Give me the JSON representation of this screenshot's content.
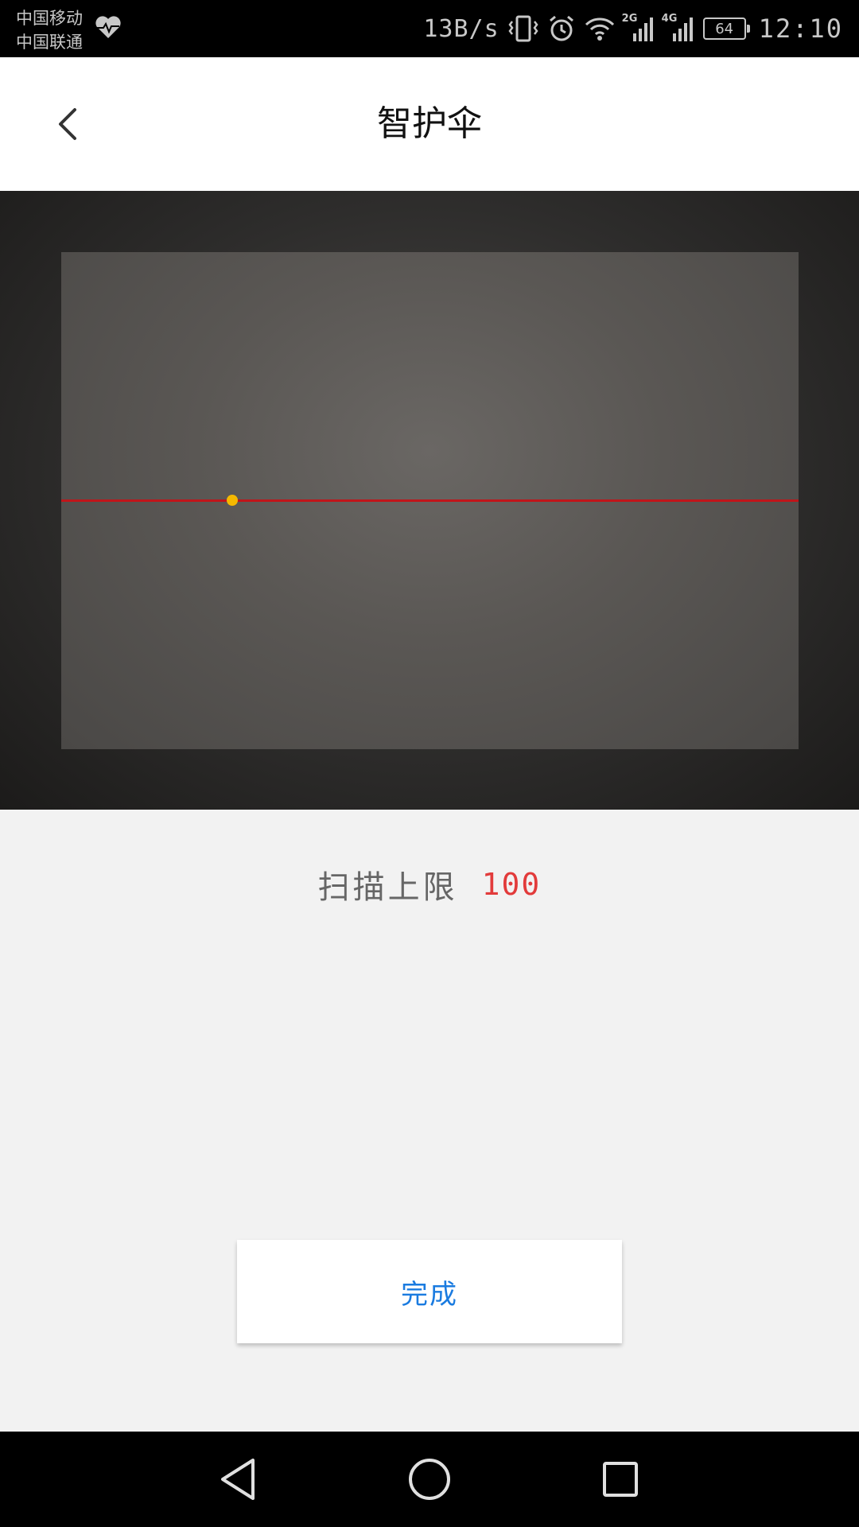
{
  "status_bar": {
    "carrier_1": "中国移动",
    "carrier_2": "中国联通",
    "net_speed": "13B/s",
    "network_1_tag": "2G",
    "network_2_tag": "4G",
    "battery": "64",
    "time": "12:10"
  },
  "header": {
    "title": "智护伞"
  },
  "scan": {
    "limit_label": "扫描上限",
    "limit_value": "100"
  },
  "actions": {
    "done_label": "完成"
  },
  "colors": {
    "scan_line": "#c0151a",
    "scan_dot": "#f5b800",
    "limit_value": "#e23b3b",
    "done_text": "#1a7be0"
  },
  "icons": {
    "back": "chevron-left-icon",
    "health": "heart-pulse-icon",
    "vibrate": "vibrate-icon",
    "alarm": "alarm-icon",
    "wifi": "wifi-icon",
    "signal": "signal-icon",
    "nav_back": "triangle-back-icon",
    "nav_home": "circle-home-icon",
    "nav_recents": "square-recents-icon"
  }
}
